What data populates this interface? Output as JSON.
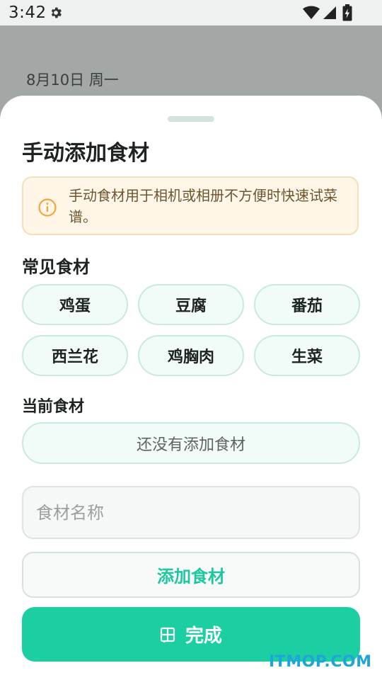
{
  "status_bar": {
    "time": "3:42",
    "icons": [
      "gear-icon",
      "wifi-icon",
      "signal-icon",
      "battery-icon"
    ]
  },
  "backdrop": {
    "date": "8月10日 周一"
  },
  "sheet": {
    "title": "手动添加食材",
    "notice": {
      "icon": "info-icon",
      "text": "手动食材用于相机或相册不方便时快速试菜谱。"
    },
    "common_section": {
      "label": "常见食材",
      "items": [
        "鸡蛋",
        "豆腐",
        "番茄",
        "西兰花",
        "鸡胸肉",
        "生菜"
      ]
    },
    "current_section": {
      "label": "当前食材",
      "empty_text": "还没有添加食材"
    },
    "input": {
      "placeholder": "食材名称",
      "value": ""
    },
    "add_button": "添加食材",
    "done_button": {
      "icon": "book-icon",
      "label": "完成"
    }
  },
  "watermark": "ITMOP.COM",
  "colors": {
    "accent": "#1ccfa3",
    "accent_text": "#1fc7a0",
    "chip_bg": "#f1fbf7",
    "chip_border": "#c9eadf",
    "notice_bg": "#fff6e8",
    "notice_border": "#f3dfb8",
    "scrim": "#a3a8a6",
    "watermark": "#1fa6d8"
  }
}
